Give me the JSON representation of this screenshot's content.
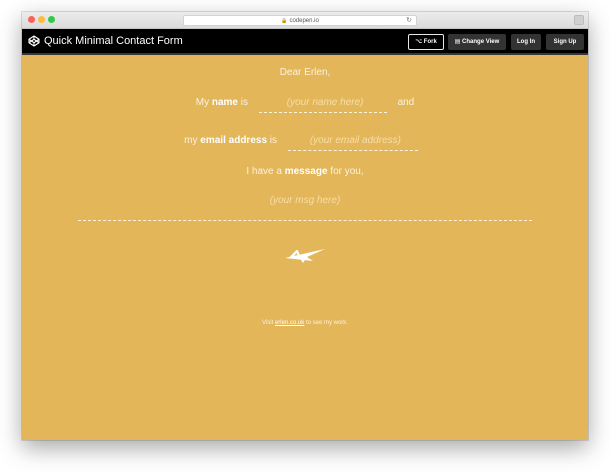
{
  "browser": {
    "url": "codepen.io",
    "icons": {
      "lock": "lock-icon",
      "reload": "reload-icon"
    }
  },
  "header": {
    "title": "Quick Minimal Contact Form",
    "logo": "codepen-logo-icon",
    "buttons": {
      "fork": "Fork",
      "change_view": "Change View",
      "login": "Log In",
      "signup": "Sign Up"
    }
  },
  "form": {
    "greeting": "Dear Erlen,",
    "name_prefix": "My",
    "name_bold": "name",
    "name_mid": "is",
    "name_placeholder": "(your name here)",
    "name_suffix": "and",
    "email_prefix": "my",
    "email_bold": "email address",
    "email_mid": "is",
    "email_placeholder": "(your email address)",
    "msg_prefix": "I have a",
    "msg_bold": "message",
    "msg_suffix": "for you,",
    "msg_placeholder": "(your msg here)",
    "send_icon": "paper-plane-icon"
  },
  "footer": {
    "prefix": "Visit",
    "link": "erlen.co.uk",
    "suffix": "to see my work."
  },
  "colors": {
    "background": "#e3b65a",
    "header": "#000000",
    "text": "#ffffff"
  }
}
